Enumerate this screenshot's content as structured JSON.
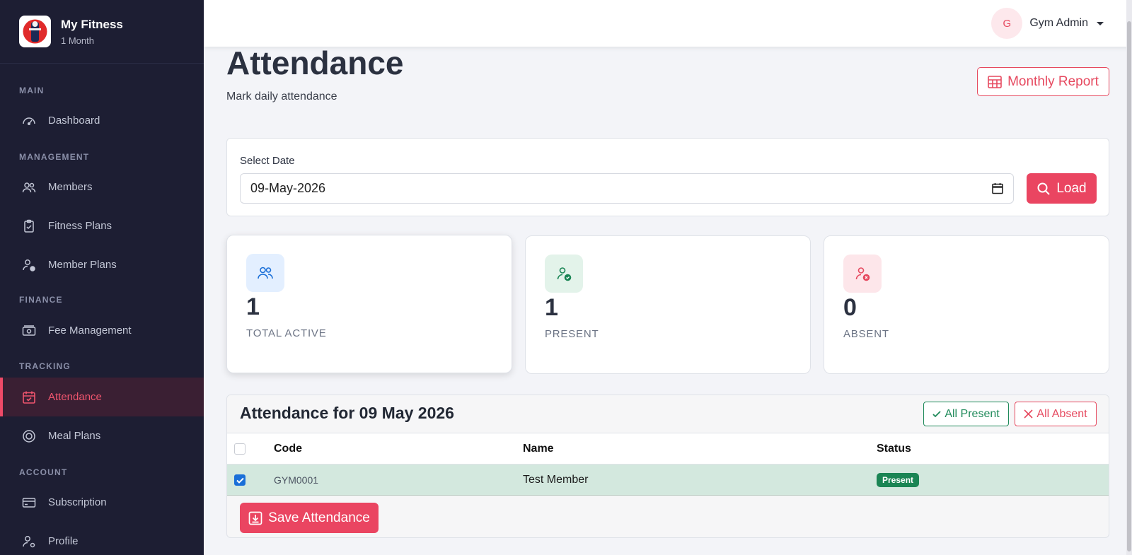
{
  "brand": {
    "name": "My Fitness",
    "subtitle": "1 Month"
  },
  "sidebar": {
    "sections": [
      {
        "label": "MAIN"
      },
      {
        "label": "MANAGEMENT"
      },
      {
        "label": "FINANCE"
      },
      {
        "label": "TRACKING"
      },
      {
        "label": "ACCOUNT"
      }
    ],
    "items": [
      {
        "label": "Dashboard",
        "icon": "gauge-icon"
      },
      {
        "label": "Members",
        "icon": "users-icon"
      },
      {
        "label": "Fitness Plans",
        "icon": "clipboard-check-icon"
      },
      {
        "label": "Member Plans",
        "icon": "user-check-icon"
      },
      {
        "label": "Fee Management",
        "icon": "cash-icon"
      },
      {
        "label": "Attendance",
        "icon": "calendar-check-icon",
        "active": true
      },
      {
        "label": "Meal Plans",
        "icon": "meal-icon"
      },
      {
        "label": "Subscription",
        "icon": "credit-card-icon"
      },
      {
        "label": "Profile",
        "icon": "user-gear-icon"
      }
    ]
  },
  "header": {
    "avatar_initial": "G",
    "user_name": "Gym Admin"
  },
  "page": {
    "title": "Attendance",
    "subtitle": "Mark daily attendance",
    "report_button": "Monthly Report"
  },
  "date_filter": {
    "label": "Select Date",
    "value": "09-May-2026",
    "load_button": "Load"
  },
  "stats": [
    {
      "value": "1",
      "label": "TOTAL ACTIVE",
      "color": "#1a6fd8",
      "bg": "#e3efff"
    },
    {
      "value": "1",
      "label": "PRESENT",
      "color": "#1a8554",
      "bg": "#e3f3ea"
    },
    {
      "value": "0",
      "label": "ABSENT",
      "color": "#e6495f",
      "bg": "#fde6ea"
    }
  ],
  "table": {
    "title": "Attendance for 09 May 2026",
    "all_present_button": "All Present",
    "all_absent_button": "All Absent",
    "columns": [
      "Code",
      "Name",
      "Status"
    ],
    "rows": [
      {
        "code": "GYM0001",
        "name": "Test Member",
        "status": "Present",
        "checked": true
      }
    ],
    "save_button": "Save Attendance"
  },
  "colors": {
    "accent": "#ea4561",
    "sidebar_bg": "#1d1e33",
    "present": "#1a8554"
  }
}
